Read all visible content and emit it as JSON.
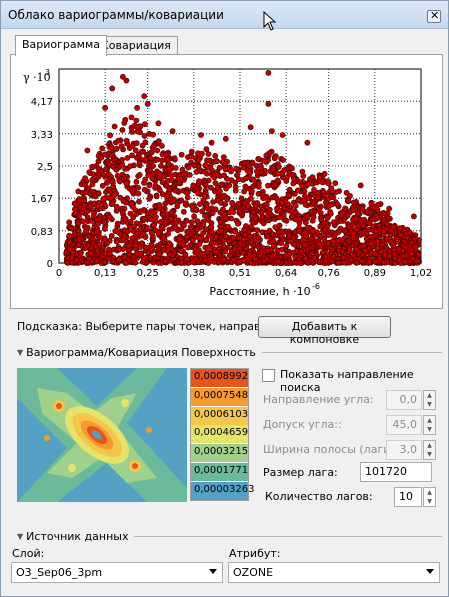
{
  "window": {
    "title": "Облако вариограммы/ковариации"
  },
  "tabs": [
    {
      "label": "Вариограмма",
      "active": true
    },
    {
      "label": "Ковариация",
      "active": false
    }
  ],
  "chart_data": {
    "type": "scatter",
    "ylabel_symbol": "γ",
    "ylabel_exp": "·10",
    "ylabel_sup": "3",
    "xlabel": "Расстояние, h ·10",
    "xlabel_sup": "-6",
    "x_ticks": [
      "0",
      "0,13",
      "0,25",
      "0,38",
      "0,51",
      "0,64",
      "0,76",
      "0,89",
      "1,02"
    ],
    "x_tick_values": [
      0,
      0.13,
      0.25,
      0.38,
      0.51,
      0.64,
      0.76,
      0.89,
      1.02
    ],
    "y_ticks": [
      "0",
      "0,83",
      "1,67",
      "2,5",
      "3,33",
      "4,17"
    ],
    "y_tick_values": [
      0,
      0.83,
      1.67,
      2.5,
      3.33,
      4.17
    ],
    "xlim": [
      0,
      1.02
    ],
    "ylim": [
      0,
      5.0
    ],
    "grid": true,
    "point_color": "#c00000",
    "envelope": [
      [
        0.0,
        0.0
      ],
      [
        0.03,
        1.2
      ],
      [
        0.06,
        2.0
      ],
      [
        0.1,
        2.7
      ],
      [
        0.15,
        3.5
      ],
      [
        0.2,
        3.8
      ],
      [
        0.25,
        3.6
      ],
      [
        0.3,
        2.9
      ],
      [
        0.35,
        2.9
      ],
      [
        0.4,
        3.0
      ],
      [
        0.45,
        2.8
      ],
      [
        0.5,
        2.6
      ],
      [
        0.55,
        2.6
      ],
      [
        0.6,
        3.0
      ],
      [
        0.65,
        2.5
      ],
      [
        0.7,
        2.3
      ],
      [
        0.75,
        2.3
      ],
      [
        0.8,
        1.9
      ],
      [
        0.85,
        1.5
      ],
      [
        0.9,
        1.6
      ],
      [
        0.95,
        1.0
      ],
      [
        1.0,
        0.8
      ],
      [
        1.02,
        0.6
      ]
    ],
    "outliers": [
      [
        0.15,
        4.5
      ],
      [
        0.18,
        4.8
      ],
      [
        0.19,
        4.7
      ],
      [
        0.24,
        4.3
      ],
      [
        0.25,
        4.1
      ],
      [
        0.22,
        4.0
      ],
      [
        0.13,
        4.0
      ],
      [
        0.59,
        4.9
      ],
      [
        0.59,
        4.1
      ],
      [
        0.54,
        3.5
      ],
      [
        0.6,
        3.4
      ],
      [
        0.47,
        3.2
      ],
      [
        0.32,
        3.4
      ],
      [
        0.08,
        2.9
      ],
      [
        0.7,
        3.1
      ],
      [
        0.85,
        2.0
      ],
      [
        0.93,
        1.4
      ],
      [
        1.0,
        1.2
      ],
      [
        0.96,
        0.9
      ],
      [
        0.4,
        3.3
      ],
      [
        0.63,
        3.3
      ],
      [
        0.43,
        3.1
      ],
      [
        0.28,
        3.6
      ]
    ]
  },
  "hint": {
    "text": "Подсказка: Выберите пары точек, направив",
    "add_button": "Добавить к компоновке"
  },
  "surface_section": {
    "title": "Вариограмма/Ковариация Поверхность"
  },
  "surface_legend": [
    {
      "label": "0,0008992",
      "color": "#e8531e"
    },
    {
      "label": "0,0007548",
      "color": "#f59a2c"
    },
    {
      "label": "0,0006103",
      "color": "#f6c64a"
    },
    {
      "label": "0,0004659",
      "color": "#e5e36a"
    },
    {
      "label": "0,0003215",
      "color": "#9fd08c"
    },
    {
      "label": "0,0001771",
      "color": "#6db99c"
    },
    {
      "label": "0,00003263",
      "color": "#54a1c4"
    }
  ],
  "search_direction": {
    "label": "Показать направление поиска",
    "checked": false
  },
  "params": {
    "angle_label": "Направление угла:",
    "angle_value": "0,0",
    "tolerance_label": "Допуск угла::",
    "tolerance_value": "45,0",
    "bandwidth_label": "Ширина полосы (лаги):",
    "bandwidth_value": "3,0",
    "lag_size_label": "Размер лага:",
    "lag_size_value": "101720",
    "lag_count_label": "Количество лагов:",
    "lag_count_value": "10"
  },
  "data_source": {
    "title": "Источник данных",
    "layer_label": "Слой:",
    "layer_value": "O3_Sep06_3pm",
    "attribute_label": "Атрибут:",
    "attribute_value": "OZONE"
  }
}
